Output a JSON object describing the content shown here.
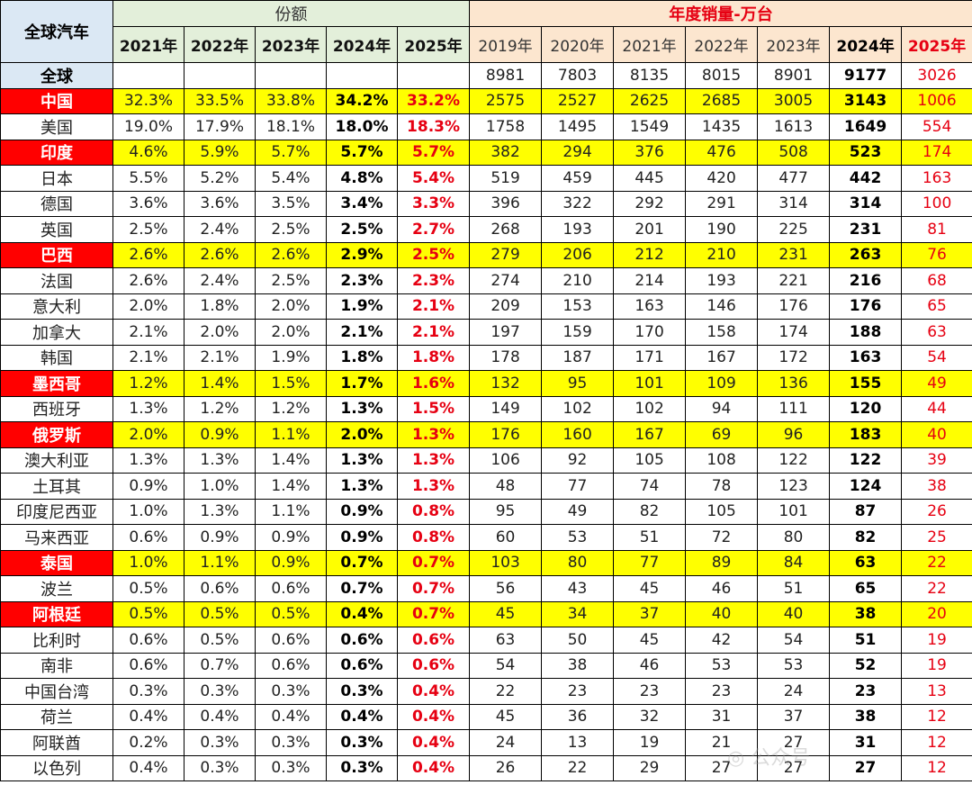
{
  "header": {
    "corner": "全球汽车",
    "share_group": "份额",
    "sales_group": "年度销量-万台",
    "share_years": [
      "2021年",
      "2022年",
      "2023年",
      "2024年",
      "2025年"
    ],
    "sales_years": [
      "2019年",
      "2020年",
      "2021年",
      "2022年",
      "2023年",
      "2024年",
      "2025年"
    ]
  },
  "rows": [
    {
      "c": "全球",
      "hl": false,
      "g": true,
      "s": [
        "",
        "",
        "",
        "",
        ""
      ],
      "v": [
        "8981",
        "7803",
        "8135",
        "8015",
        "8901",
        "9177",
        "3026"
      ]
    },
    {
      "c": "中国",
      "hl": true,
      "s": [
        "32.3%",
        "33.5%",
        "33.8%",
        "34.2%",
        "33.2%"
      ],
      "v": [
        "2575",
        "2527",
        "2625",
        "2685",
        "3005",
        "3143",
        "1006"
      ]
    },
    {
      "c": "美国",
      "hl": false,
      "s": [
        "19.0%",
        "17.9%",
        "18.1%",
        "18.0%",
        "18.3%"
      ],
      "v": [
        "1758",
        "1495",
        "1549",
        "1435",
        "1613",
        "1649",
        "554"
      ]
    },
    {
      "c": "印度",
      "hl": true,
      "s": [
        "4.6%",
        "5.9%",
        "5.7%",
        "5.7%",
        "5.7%"
      ],
      "v": [
        "382",
        "294",
        "376",
        "476",
        "508",
        "523",
        "174"
      ]
    },
    {
      "c": "日本",
      "hl": false,
      "s": [
        "5.5%",
        "5.2%",
        "5.4%",
        "4.8%",
        "5.4%"
      ],
      "v": [
        "519",
        "459",
        "445",
        "420",
        "477",
        "442",
        "163"
      ]
    },
    {
      "c": "德国",
      "hl": false,
      "s": [
        "3.6%",
        "3.6%",
        "3.5%",
        "3.4%",
        "3.3%"
      ],
      "v": [
        "396",
        "322",
        "292",
        "291",
        "314",
        "314",
        "100"
      ]
    },
    {
      "c": "英国",
      "hl": false,
      "s": [
        "2.5%",
        "2.4%",
        "2.5%",
        "2.5%",
        "2.7%"
      ],
      "v": [
        "268",
        "193",
        "201",
        "190",
        "225",
        "231",
        "81"
      ]
    },
    {
      "c": "巴西",
      "hl": true,
      "s": [
        "2.6%",
        "2.6%",
        "2.6%",
        "2.9%",
        "2.5%"
      ],
      "v": [
        "279",
        "206",
        "212",
        "210",
        "231",
        "263",
        "76"
      ]
    },
    {
      "c": "法国",
      "hl": false,
      "s": [
        "2.6%",
        "2.4%",
        "2.5%",
        "2.3%",
        "2.3%"
      ],
      "v": [
        "274",
        "210",
        "214",
        "193",
        "221",
        "216",
        "68"
      ]
    },
    {
      "c": "意大利",
      "hl": false,
      "s": [
        "2.0%",
        "1.8%",
        "2.0%",
        "1.9%",
        "2.1%"
      ],
      "v": [
        "209",
        "153",
        "163",
        "146",
        "176",
        "176",
        "65"
      ]
    },
    {
      "c": "加拿大",
      "hl": false,
      "s": [
        "2.1%",
        "2.0%",
        "2.0%",
        "2.1%",
        "2.1%"
      ],
      "v": [
        "197",
        "159",
        "170",
        "158",
        "174",
        "188",
        "63"
      ]
    },
    {
      "c": "韩国",
      "hl": false,
      "s": [
        "2.1%",
        "2.1%",
        "1.9%",
        "1.8%",
        "1.8%"
      ],
      "v": [
        "178",
        "187",
        "171",
        "167",
        "172",
        "163",
        "54"
      ]
    },
    {
      "c": "墨西哥",
      "hl": true,
      "s": [
        "1.2%",
        "1.4%",
        "1.5%",
        "1.7%",
        "1.6%"
      ],
      "v": [
        "132",
        "95",
        "101",
        "109",
        "136",
        "155",
        "49"
      ]
    },
    {
      "c": "西班牙",
      "hl": false,
      "s": [
        "1.3%",
        "1.2%",
        "1.2%",
        "1.3%",
        "1.5%"
      ],
      "v": [
        "149",
        "102",
        "102",
        "94",
        "111",
        "120",
        "44"
      ]
    },
    {
      "c": "俄罗斯",
      "hl": true,
      "s": [
        "2.0%",
        "0.9%",
        "1.1%",
        "2.0%",
        "1.3%"
      ],
      "v": [
        "176",
        "160",
        "167",
        "69",
        "96",
        "183",
        "40"
      ]
    },
    {
      "c": "澳大利亚",
      "hl": false,
      "s": [
        "1.3%",
        "1.3%",
        "1.4%",
        "1.3%",
        "1.3%"
      ],
      "v": [
        "106",
        "92",
        "105",
        "108",
        "122",
        "122",
        "39"
      ]
    },
    {
      "c": "土耳其",
      "hl": false,
      "s": [
        "0.9%",
        "1.0%",
        "1.4%",
        "1.3%",
        "1.3%"
      ],
      "v": [
        "48",
        "77",
        "74",
        "78",
        "123",
        "124",
        "38"
      ]
    },
    {
      "c": "印度尼西亚",
      "hl": false,
      "s": [
        "1.0%",
        "1.3%",
        "1.1%",
        "0.9%",
        "0.8%"
      ],
      "v": [
        "95",
        "49",
        "82",
        "105",
        "101",
        "87",
        "26"
      ]
    },
    {
      "c": "马来西亚",
      "hl": false,
      "s": [
        "0.6%",
        "0.9%",
        "0.9%",
        "0.9%",
        "0.8%"
      ],
      "v": [
        "60",
        "53",
        "51",
        "72",
        "80",
        "82",
        "25"
      ]
    },
    {
      "c": "泰国",
      "hl": true,
      "s": [
        "1.0%",
        "1.1%",
        "0.9%",
        "0.7%",
        "0.7%"
      ],
      "v": [
        "103",
        "80",
        "77",
        "89",
        "84",
        "63",
        "22"
      ]
    },
    {
      "c": "波兰",
      "hl": false,
      "s": [
        "0.5%",
        "0.6%",
        "0.6%",
        "0.7%",
        "0.7%"
      ],
      "v": [
        "56",
        "43",
        "45",
        "46",
        "51",
        "65",
        "22"
      ]
    },
    {
      "c": "阿根廷",
      "hl": true,
      "s": [
        "0.5%",
        "0.5%",
        "0.5%",
        "0.4%",
        "0.7%"
      ],
      "v": [
        "45",
        "34",
        "37",
        "40",
        "40",
        "38",
        "20"
      ]
    },
    {
      "c": "比利时",
      "hl": false,
      "s": [
        "0.6%",
        "0.5%",
        "0.6%",
        "0.6%",
        "0.6%"
      ],
      "v": [
        "63",
        "50",
        "45",
        "42",
        "54",
        "51",
        "19"
      ]
    },
    {
      "c": "南非",
      "hl": false,
      "s": [
        "0.6%",
        "0.7%",
        "0.6%",
        "0.6%",
        "0.6%"
      ],
      "v": [
        "54",
        "38",
        "46",
        "53",
        "53",
        "52",
        "19"
      ]
    },
    {
      "c": "中国台湾",
      "hl": false,
      "s": [
        "0.3%",
        "0.3%",
        "0.3%",
        "0.3%",
        "0.4%"
      ],
      "v": [
        "22",
        "23",
        "23",
        "23",
        "24",
        "23",
        "13"
      ]
    },
    {
      "c": "荷兰",
      "hl": false,
      "s": [
        "0.4%",
        "0.4%",
        "0.4%",
        "0.4%",
        "0.4%"
      ],
      "v": [
        "45",
        "36",
        "32",
        "31",
        "37",
        "38",
        "12"
      ]
    },
    {
      "c": "阿联酋",
      "hl": false,
      "s": [
        "0.2%",
        "0.3%",
        "0.3%",
        "0.3%",
        "0.4%"
      ],
      "v": [
        "24",
        "13",
        "19",
        "21",
        "27",
        "31",
        "12"
      ]
    },
    {
      "c": "以色列",
      "hl": false,
      "s": [
        "0.4%",
        "0.3%",
        "0.3%",
        "0.3%",
        "0.4%"
      ],
      "v": [
        "26",
        "22",
        "29",
        "27",
        "27",
        "27",
        "12"
      ]
    }
  ]
}
